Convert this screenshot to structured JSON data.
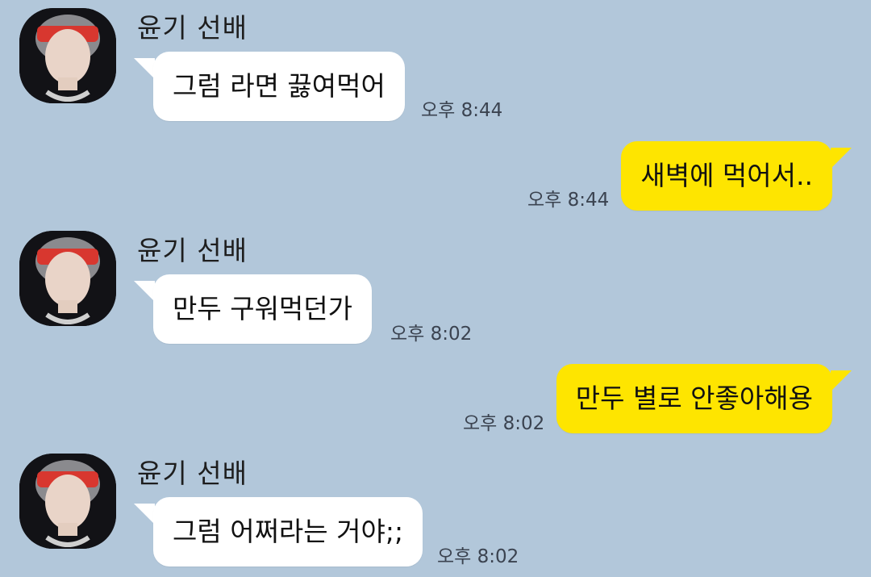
{
  "colors": {
    "background": "#b2c7da",
    "received_bubble": "#ffffff",
    "sent_bubble": "#fee500"
  },
  "messages": [
    {
      "direction": "received",
      "sender": "윤기 선배",
      "text": "그럼 라면 끓여먹어",
      "time": "오후 8:44",
      "avatar_icon": "profile-photo"
    },
    {
      "direction": "sent",
      "text": "새벽에 먹어서..",
      "time": "오후 8:44"
    },
    {
      "direction": "received",
      "sender": "윤기 선배",
      "text": "만두 구워먹던가",
      "time": "오후 8:02",
      "avatar_icon": "profile-photo"
    },
    {
      "direction": "sent",
      "text": "만두 별로 안좋아해용",
      "time": "오후 8:02"
    },
    {
      "direction": "received",
      "sender": "윤기 선배",
      "text": "그럼 어쩌라는 거야;;",
      "time": "오후 8:02",
      "avatar_icon": "profile-photo"
    }
  ]
}
